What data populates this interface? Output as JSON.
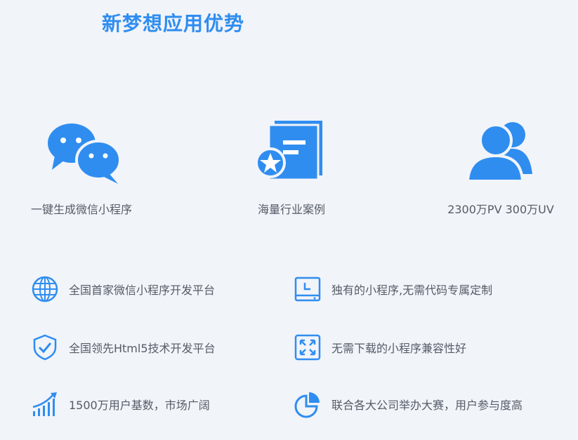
{
  "header": {
    "title": "新梦想应用优势"
  },
  "features": [
    {
      "icon": "wechat-icon",
      "label": "一键生成微信小程序"
    },
    {
      "icon": "case-book-icon",
      "label": "海量行业案例"
    },
    {
      "icon": "users-icon",
      "label": "2300万PV  300万UV"
    }
  ],
  "advantages": [
    {
      "icon": "globe-icon",
      "text": "全国首家微信小程序开发平台"
    },
    {
      "icon": "clock-device-icon",
      "text": "独有的小程序,无需代码专属定制"
    },
    {
      "icon": "shield-check-icon",
      "text": "全国领先Html5技术开发平台"
    },
    {
      "icon": "expand-icon",
      "text": "无需下载的小程序兼容性好"
    },
    {
      "icon": "growth-chart-icon",
      "text": "1500万用户基数，市场广阔"
    },
    {
      "icon": "pie-chart-icon",
      "text": "联合各大公司举办大赛，用户参与度高"
    }
  ],
  "colors": {
    "accent": "#2f8df0",
    "text": "#555b66",
    "background": "#f1f4f9"
  }
}
